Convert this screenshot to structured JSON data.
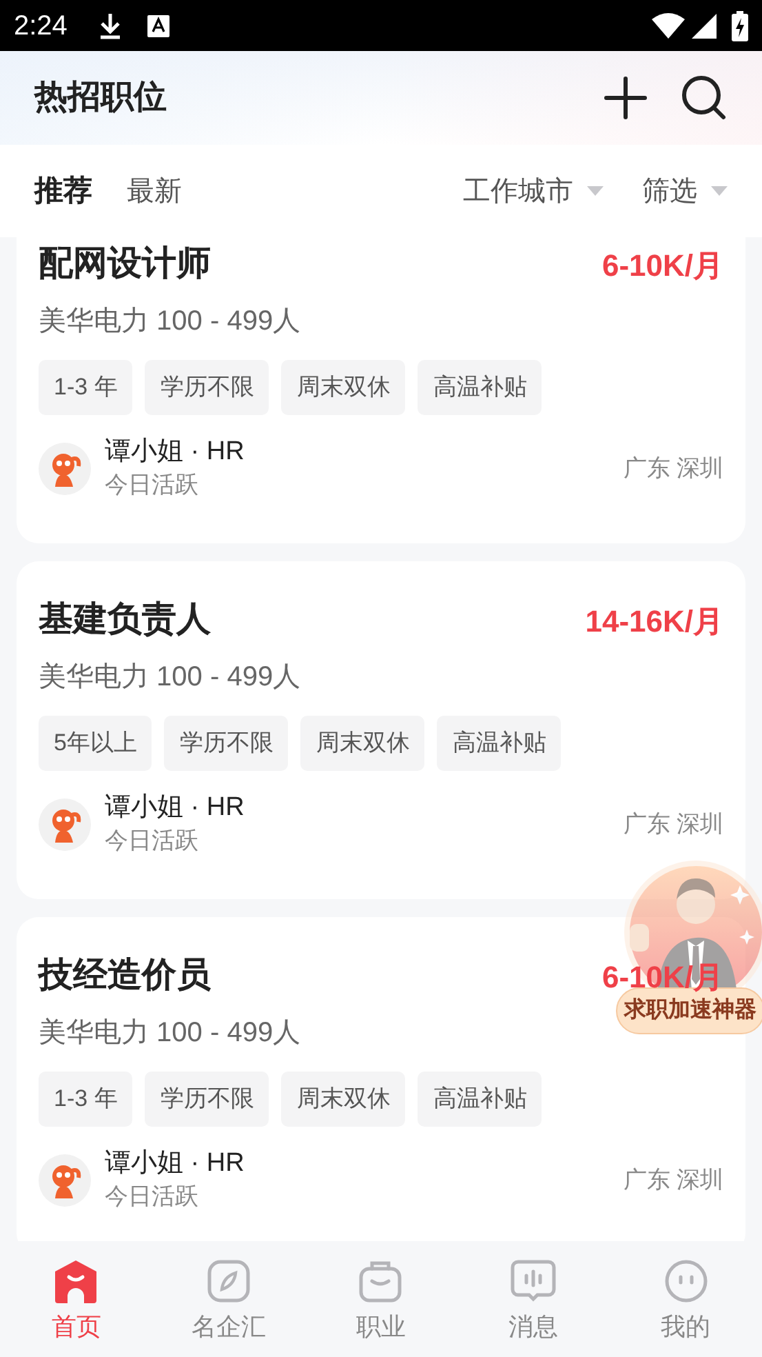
{
  "status_bar": {
    "time": "2:24"
  },
  "header": {
    "title": "热招职位"
  },
  "tabs": [
    {
      "label": "推荐",
      "selected": true
    },
    {
      "label": "最新",
      "selected": false
    }
  ],
  "filters": [
    {
      "label": "工作城市"
    },
    {
      "label": "筛选"
    }
  ],
  "jobs": [
    {
      "title": "配网设计师",
      "salary": "6-10K/月",
      "company": "美华电力 100 - 499人",
      "tags": [
        "1-3 年",
        "学历不限",
        "周末双休",
        "高温补贴"
      ],
      "recruiter": "谭小姐 · HR",
      "activity": "今日活跃",
      "location": "广东 深圳"
    },
    {
      "title": "基建负责人",
      "salary": "14-16K/月",
      "company": "美华电力 100 - 499人",
      "tags": [
        "5年以上",
        "学历不限",
        "周末双休",
        "高温补贴"
      ],
      "recruiter": "谭小姐 · HR",
      "activity": "今日活跃",
      "location": "广东 深圳"
    },
    {
      "title": "技经造价员",
      "salary": "6-10K/月",
      "company": "美华电力 100 - 499人",
      "tags": [
        "1-3 年",
        "学历不限",
        "周末双休",
        "高温补贴"
      ],
      "recruiter": "谭小姐 · HR",
      "activity": "今日活跃",
      "location": "广东 深圳"
    }
  ],
  "promo": {
    "label": "求职加速神器"
  },
  "nav": [
    {
      "label": "首页",
      "selected": true
    },
    {
      "label": "名企汇",
      "selected": false
    },
    {
      "label": "职业",
      "selected": false
    },
    {
      "label": "消息",
      "selected": false
    },
    {
      "label": "我的",
      "selected": false
    }
  ]
}
